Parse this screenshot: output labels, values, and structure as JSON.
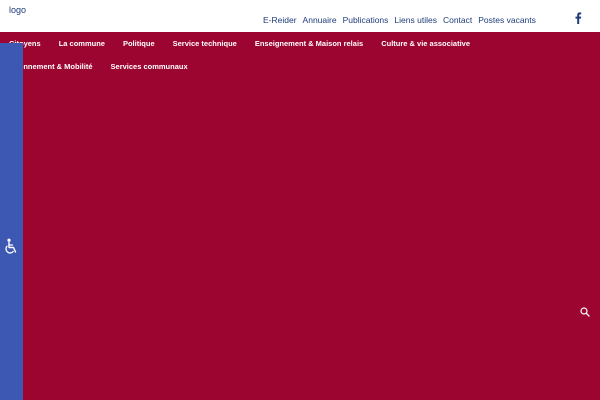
{
  "header": {
    "logo_text": "logo",
    "top_links": [
      "E-Reider",
      "Annuaire",
      "Publications",
      "Liens utiles",
      "Contact",
      "Postes vacants"
    ],
    "social_icon": "facebook-icon"
  },
  "main_nav": {
    "row1": [
      "Citoyens",
      "La commune",
      "Politique",
      "Service technique",
      "Enseignement & Maison relais",
      "Culture & vie associative"
    ],
    "row2": [
      "Environnement & Mobilité",
      "Services communaux"
    ]
  },
  "accessibility": {
    "icon": "wheelchair-icon"
  },
  "search": {
    "icon": "search-icon"
  },
  "colors": {
    "primary": "#9c0530",
    "accent": "#3d58b2",
    "link": "#1f3b7a"
  }
}
